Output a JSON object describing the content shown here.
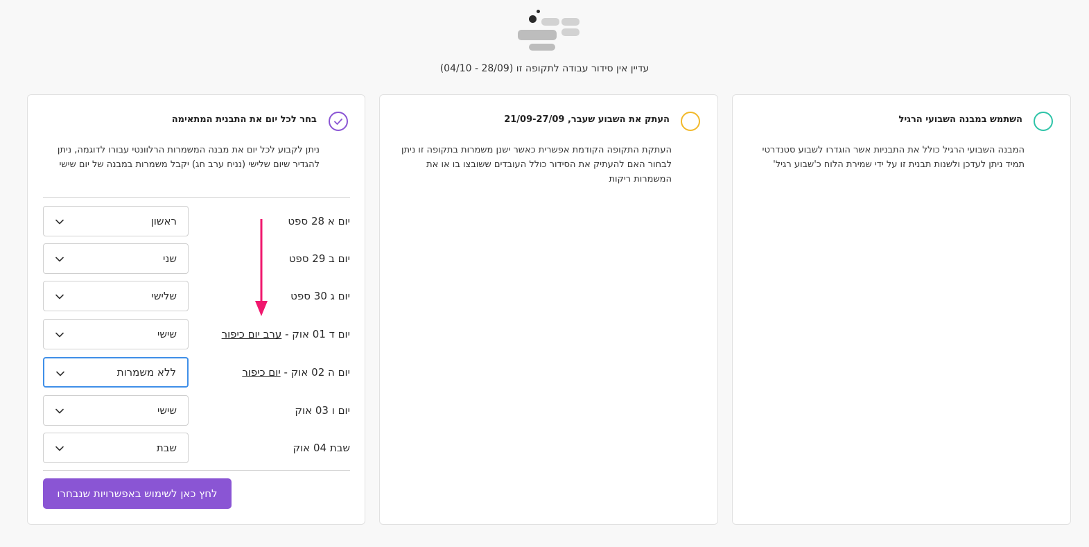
{
  "header": {
    "empty_message": "עדיין אין סידור עבודה לתקופה זו (28/09 - 04/10)"
  },
  "cards": {
    "weekly": {
      "title": "השתמש במבנה השבועי הרגיל",
      "description": "המבנה השבועי הרגיל כולל את התבניות אשר הוגדרו לשבוע סטנדרטי תמיד ניתן לעדכן ולשנות תבנית זו על ידי שמירת הלוח כ'שבוע רגיל'",
      "radio_color": "#2ec4a8"
    },
    "copy": {
      "title": "העתק את השבוע שעבר, 21/09-27/09",
      "description": "העתקת התקופה הקודמת אפשרית כאשר ישנן משמרות בתקופה זו ניתן לבחור האם להעתיק את הסידור כולל העובדים ששובצו בו או את המשמרות ריקות",
      "radio_color": "#f2b92b"
    },
    "custom": {
      "title": "בחר לכל יום את התבנית המתאימה",
      "description": "ניתן לקבוע לכל יום את מבנה המשמרות הרלוונטי עבורו לדוגמה, ניתן להגדיר שיום שלישי (נניח ערב חג) יקבל משמרות במבנה של יום שישי",
      "radio_color": "#8a55d4",
      "days": [
        {
          "label": "יום א 28 ספט",
          "holiday": "",
          "value": "ראשון"
        },
        {
          "label": "יום ב 29 ספט",
          "holiday": "",
          "value": "שני"
        },
        {
          "label": "יום ג 30 ספט",
          "holiday": "",
          "value": "שלישי"
        },
        {
          "label": "יום ד 01 אוק - ",
          "holiday": "ערב יום כיפור",
          "value": "שישי"
        },
        {
          "label": "יום ה 02 אוק - ",
          "holiday": "יום כיפור",
          "value": "ללא משמרות"
        },
        {
          "label": "יום ו 03 אוק",
          "holiday": "",
          "value": "שישי"
        },
        {
          "label": "שבת 04 אוק",
          "holiday": "",
          "value": "שבת"
        }
      ],
      "apply_label": "לחץ כאן לשימוש באפשרויות שנבחרו"
    }
  },
  "icons": {
    "check": "check-icon",
    "chevron": "chevron-down-icon",
    "arrow": "arrow-down-icon"
  },
  "colors": {
    "accent": "#8a55d4",
    "annotation_arrow": "#f0186e",
    "focus_border": "#3f8fe8"
  }
}
